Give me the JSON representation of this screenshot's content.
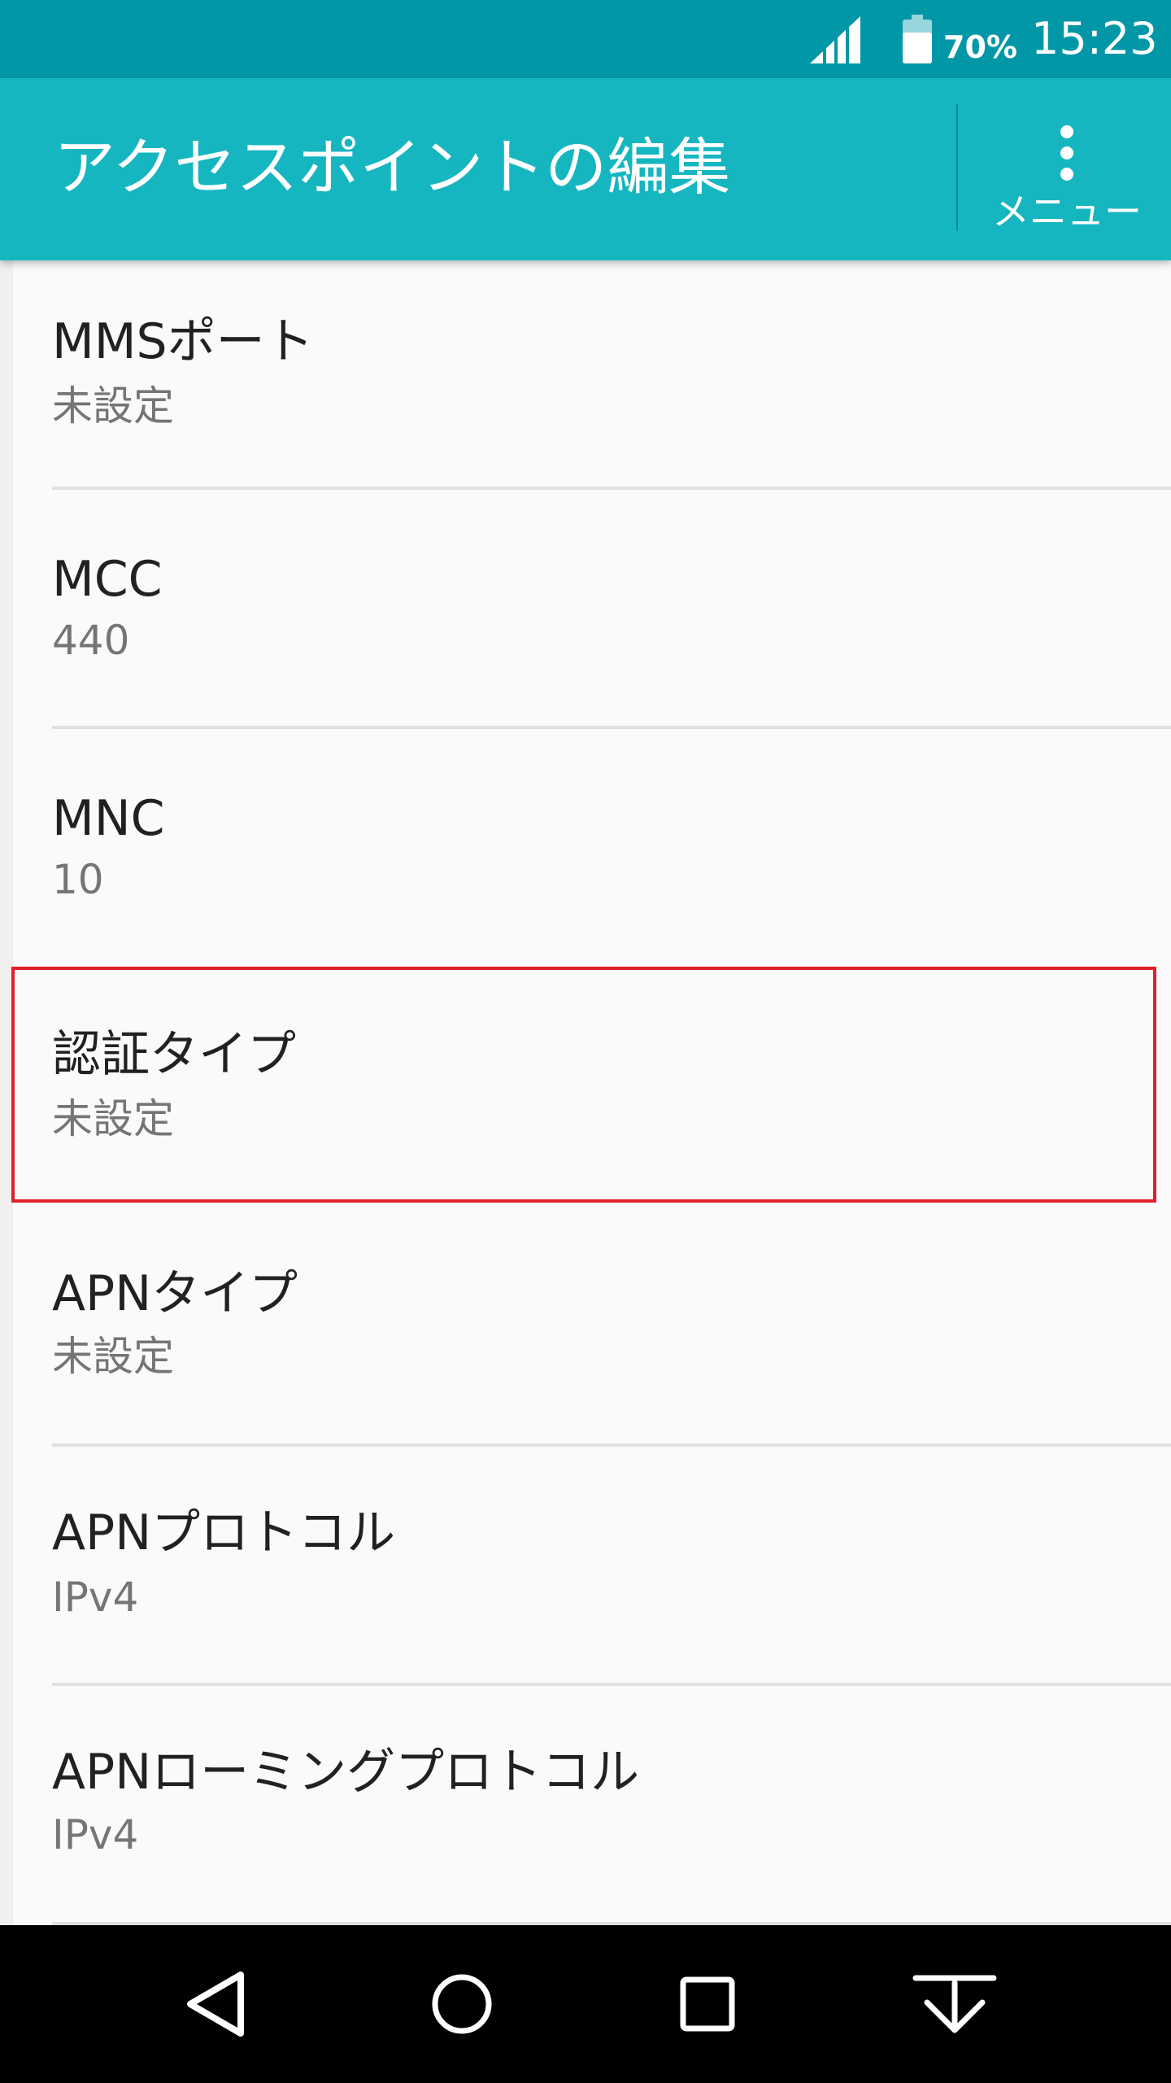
{
  "status_bar": {
    "battery_percent": "70%",
    "time": "15:23",
    "icons": [
      "signal-icon",
      "battery-icon"
    ]
  },
  "app_bar": {
    "title": "アクセスポイントの編集",
    "menu_label": "メニュー",
    "menu_icon": "more-vert-icon"
  },
  "settings": {
    "items": [
      {
        "title": "MMSポート",
        "value": "未設定"
      },
      {
        "title": "MCC",
        "value": "440"
      },
      {
        "title": "MNC",
        "value": "10"
      },
      {
        "title": "認証タイプ",
        "value": "未設定"
      },
      {
        "title": "APNタイプ",
        "value": "未設定"
      },
      {
        "title": "APNプロトコル",
        "value": "IPv4"
      },
      {
        "title": "APNローミングプロトコル",
        "value": "IPv4"
      }
    ],
    "highlighted_item": "認証タイプ"
  },
  "nav_bar": {
    "icons": [
      "back-icon",
      "home-icon",
      "recents-icon",
      "hide-keyboard-icon"
    ]
  },
  "colors": {
    "status_bar": "#0297a7",
    "app_bar": "#16b6c1",
    "highlight": "#e0202a"
  }
}
